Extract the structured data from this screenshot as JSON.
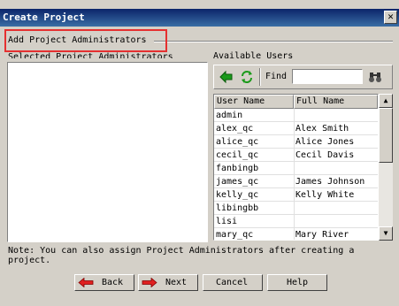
{
  "window": {
    "title": "Create Project",
    "close_label": "✕"
  },
  "step": {
    "title": "Add Project Administrators"
  },
  "selected": {
    "label": "Selected Project Administrators"
  },
  "available": {
    "label": "Available Users",
    "find_label": "Find",
    "find_value": "",
    "columns": {
      "user_name": "User Name",
      "full_name": "Full Name"
    },
    "rows": [
      {
        "user": "admin",
        "full": ""
      },
      {
        "user": "alex_qc",
        "full": "Alex Smith"
      },
      {
        "user": "alice_qc",
        "full": "Alice Jones"
      },
      {
        "user": "cecil_qc",
        "full": "Cecil Davis"
      },
      {
        "user": "fanbingb",
        "full": ""
      },
      {
        "user": "james_qc",
        "full": "James Johnson"
      },
      {
        "user": "kelly_qc",
        "full": "Kelly White"
      },
      {
        "user": "libingbb",
        "full": ""
      },
      {
        "user": "lisi",
        "full": ""
      },
      {
        "user": "mary_qc",
        "full": "Mary River"
      }
    ]
  },
  "note": "Note: You can also assign Project Administrators after creating a project.",
  "buttons": {
    "back": "Back",
    "next": "Next",
    "cancel": "Cancel",
    "help": "Help"
  },
  "icons": {
    "arrow_color": "#e02020",
    "toolbar_arrow_color": "#1a9a1a"
  }
}
